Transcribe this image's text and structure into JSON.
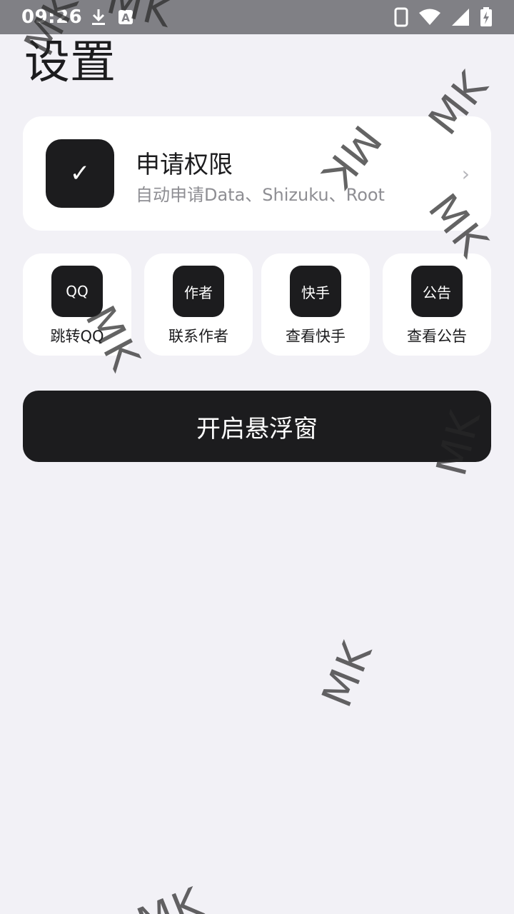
{
  "status_bar": {
    "time": "09:26",
    "left_icons": [
      "download-icon",
      "text-recognition-icon"
    ],
    "right_icons": [
      "phone-icon",
      "wifi-icon",
      "signal-icon",
      "battery-charging-icon"
    ]
  },
  "page": {
    "title": "设置"
  },
  "permission_card": {
    "icon_glyph": "✓",
    "title": "申请权限",
    "subtitle": "自动申请Data、Shizuku、Root",
    "chevron": "›"
  },
  "quick_actions": [
    {
      "icon_text": "QQ",
      "label": "跳转QQ"
    },
    {
      "icon_text": "作者",
      "label": "联系作者"
    },
    {
      "icon_text": "快手",
      "label": "查看快手"
    },
    {
      "icon_text": "公告",
      "label": "查看公告"
    }
  ],
  "main_button": {
    "label": "开启悬浮窗"
  },
  "watermark_text": "MK",
  "colors": {
    "background": "#f2f1f6",
    "card": "#ffffff",
    "dark": "#1c1c1e",
    "status_bar": "#808085",
    "secondary_text": "#8e8e93"
  }
}
